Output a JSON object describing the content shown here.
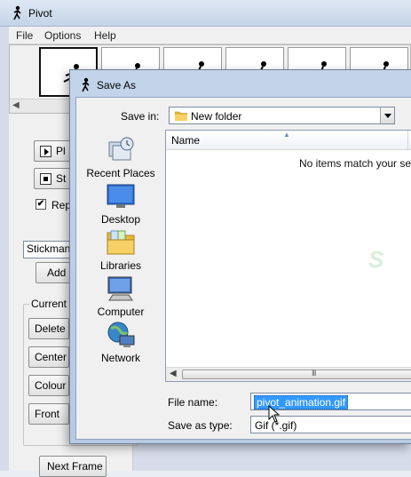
{
  "main_window": {
    "title": "Pivot",
    "menu": [
      "File",
      "Options",
      "Help"
    ],
    "buttons": {
      "play": "Pl",
      "stop": "St",
      "add_figure": "Add F",
      "delete": "Delete",
      "center": "Center",
      "colour": "Colour",
      "front": "Front",
      "next_frame": "Next Frame"
    },
    "repeat_label": "Rep",
    "repeat_checked": "✔",
    "figure_type": "Stickman",
    "current_figure_group": "Current F"
  },
  "save_dialog": {
    "title": "Save As",
    "save_in_label": "Save in:",
    "save_in_value": "New folder",
    "places": [
      "Recent Places",
      "Desktop",
      "Libraries",
      "Computer",
      "Network"
    ],
    "column_name": "Name",
    "empty_message": "No items match your se",
    "scroll_grip": "III",
    "file_name_label": "File name:",
    "file_name_value": "pivot_animation.gif",
    "save_as_type_label": "Save as type:",
    "save_as_type_value": "Gif (*.gif)"
  }
}
